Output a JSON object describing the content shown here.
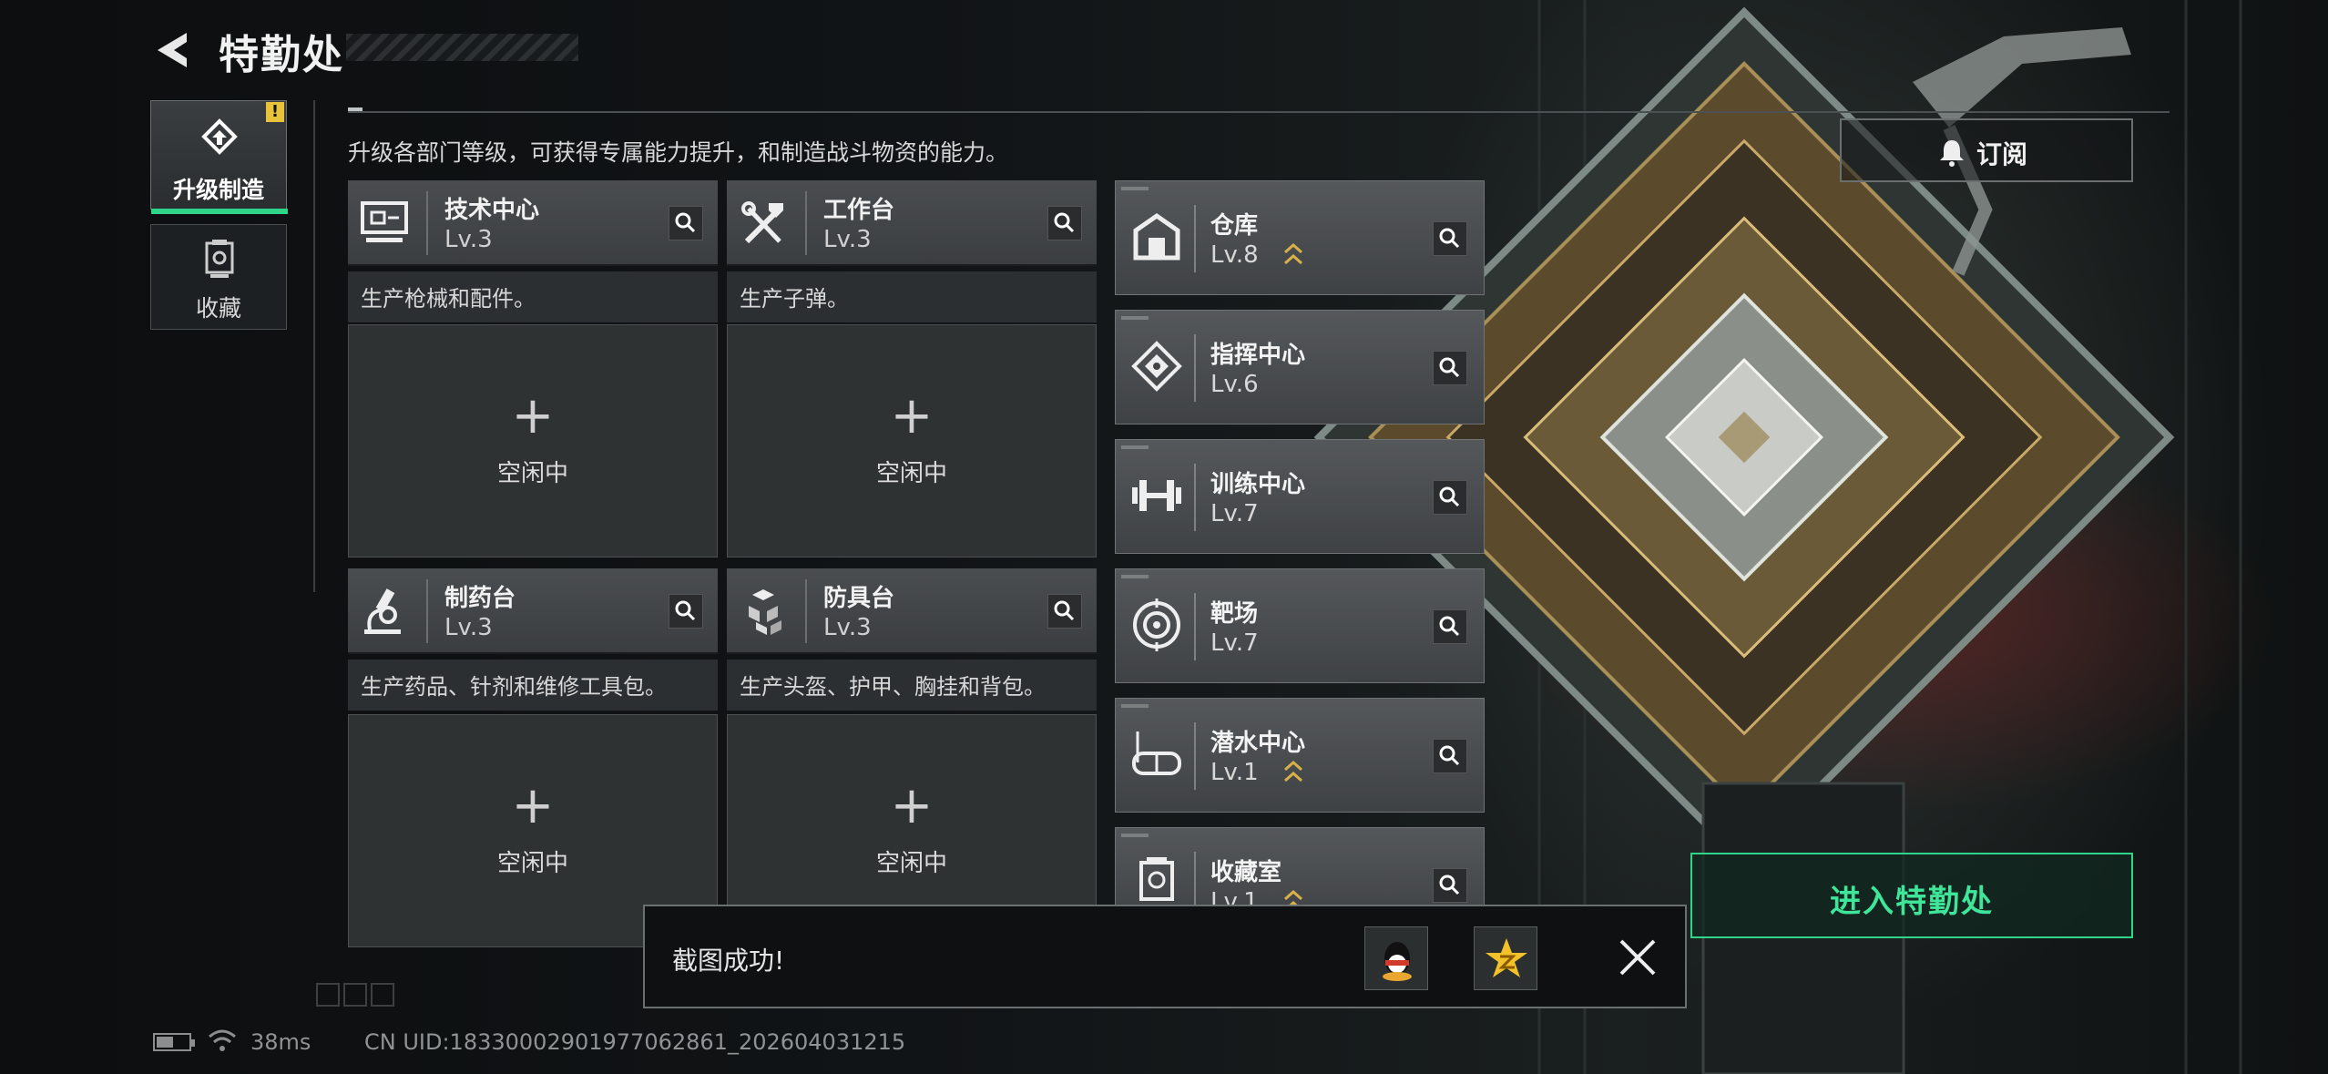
{
  "header": {
    "title": "特勤处",
    "subtitle": "升级各部门等级，可获得专属能力提升，和制造战斗物资的能力。"
  },
  "nav": {
    "items": [
      {
        "label": "升级制造",
        "active": true,
        "badge": "!"
      },
      {
        "label": "收藏",
        "active": false
      }
    ]
  },
  "workshops": [
    {
      "name": "技术中心",
      "level": "Lv.3",
      "desc": "生产枪械和配件。",
      "status": "空闲中",
      "icon": "computer-icon"
    },
    {
      "name": "工作台",
      "level": "Lv.3",
      "desc": "生产子弹。",
      "status": "空闲中",
      "icon": "tools-icon"
    },
    {
      "name": "制药台",
      "level": "Lv.3",
      "desc": "生产药品、针剂和维修工具包。",
      "status": "空闲中",
      "icon": "microscope-icon"
    },
    {
      "name": "防具台",
      "level": "Lv.3",
      "desc": "生产头盔、护甲、胸挂和背包。",
      "status": "空闲中",
      "icon": "cubes-icon"
    }
  ],
  "facilities": [
    {
      "name": "仓库",
      "level": "Lv.8",
      "upgradable": true,
      "icon": "warehouse-icon"
    },
    {
      "name": "指挥中心",
      "level": "Lv.6",
      "upgradable": false,
      "icon": "command-icon"
    },
    {
      "name": "训练中心",
      "level": "Lv.7",
      "upgradable": false,
      "icon": "dumbbell-icon"
    },
    {
      "name": "靶场",
      "level": "Lv.7",
      "upgradable": false,
      "icon": "target-icon"
    },
    {
      "name": "潜水中心",
      "level": "Lv.1",
      "upgradable": true,
      "icon": "diving-mask-icon"
    },
    {
      "name": "收藏室",
      "level": "Lv.1",
      "upgradable": true,
      "icon": "trophy-icon"
    }
  ],
  "subscribe": {
    "label": "订阅",
    "icon": "bell-icon"
  },
  "enter_button": {
    "label": "进入特勤处"
  },
  "toast": {
    "message": "截图成功!",
    "share_icons": [
      "qq-icon",
      "qzone-icon"
    ],
    "close_icon": "close-icon"
  },
  "status": {
    "ping": "38ms",
    "uid": "CN UID:1833000290197706286​1_202604031215"
  },
  "colors": {
    "accent_green": "#2fd68a",
    "upgrade_chevron": "#d9b04a",
    "warning": "#e8c33a"
  }
}
